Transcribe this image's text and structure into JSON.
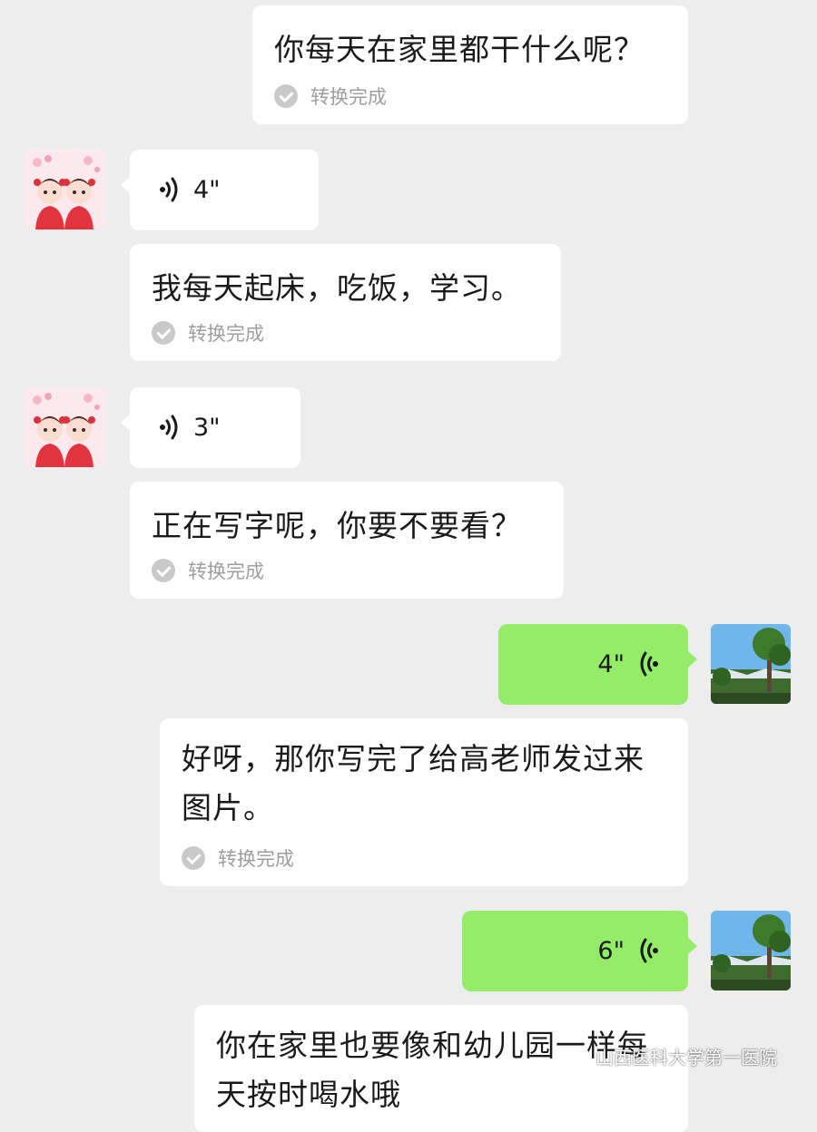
{
  "messages": [
    {
      "side": "right",
      "kind": "text",
      "text": "你每天在家里都干什么呢？",
      "status": "转换完成"
    },
    {
      "side": "left",
      "kind": "voice",
      "duration": "4\""
    },
    {
      "side": "left",
      "kind": "text",
      "text": "我每天起床，吃饭，学习。",
      "status": "转换完成"
    },
    {
      "side": "left",
      "kind": "voice",
      "duration": "3\""
    },
    {
      "side": "left",
      "kind": "text",
      "text": "正在写字呢，你要不要看？",
      "status": "转换完成"
    },
    {
      "side": "right",
      "kind": "voice",
      "duration": "4\""
    },
    {
      "side": "right",
      "kind": "text",
      "text": "好呀，那你写完了给高老师发过来图片。",
      "status": "转换完成"
    },
    {
      "side": "right",
      "kind": "voice",
      "duration": "6\""
    },
    {
      "side": "right",
      "kind": "text",
      "text": "你在家里也要像和幼儿园一样每天按时喝水哦",
      "status": ""
    }
  ],
  "watermark": {
    "text": "山西医科大学第一医院",
    "icon": "wechat-icon"
  },
  "colors": {
    "background": "#ededed",
    "bubble_self": "#95ec69",
    "bubble_other": "#ffffff",
    "status_text": "#9e9e9e"
  }
}
